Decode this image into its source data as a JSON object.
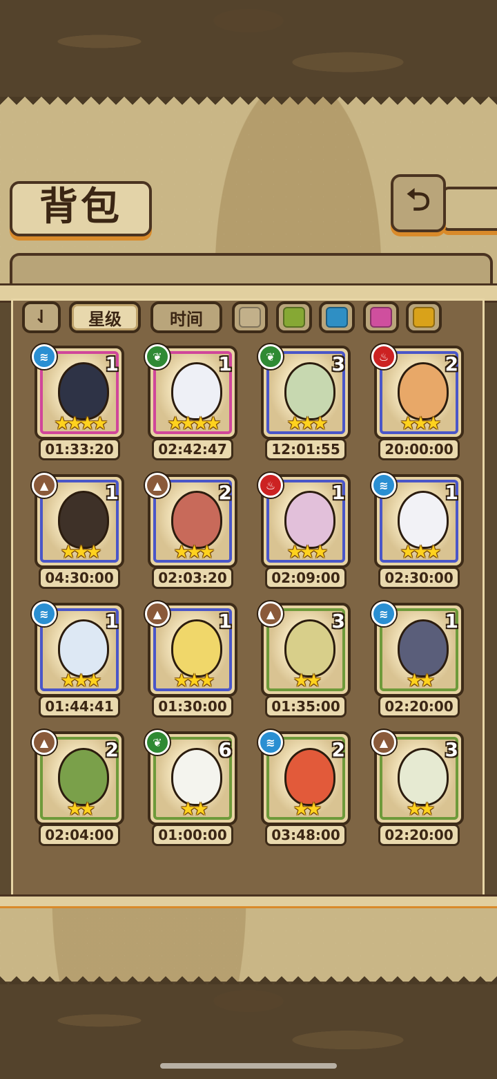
{
  "title": "背包",
  "back_icon": "⮌",
  "filters": {
    "sort_label": "⇃",
    "star_label": "星级",
    "time_label": "时间",
    "colors": [
      "#c2b08a",
      "#86a834",
      "#2f8fc4",
      "#cf4f9e",
      "#d9a21a"
    ]
  },
  "element_colors": {
    "water": "#2a8fd2",
    "leaf": "#2f8a34",
    "fire": "#cc2222",
    "earth": "#8a5a3a"
  },
  "rarity_colors": {
    "4": "#d0469a",
    "3": "#4a56c8",
    "2": "#6e9a3a"
  },
  "items": [
    {
      "count": "1",
      "stars": "★★★★",
      "timer": "01:33:20",
      "element": "water",
      "rarity": "4",
      "egg": "#2e3346"
    },
    {
      "count": "1",
      "stars": "★★★★",
      "timer": "02:42:47",
      "element": "leaf",
      "rarity": "4",
      "egg": "#eef0f6"
    },
    {
      "count": "3",
      "stars": "★★★",
      "timer": "12:01:55",
      "element": "leaf",
      "rarity": "3",
      "egg": "#c7d8b0"
    },
    {
      "count": "2",
      "stars": "★★★",
      "timer": "20:00:00",
      "element": "fire",
      "rarity": "3",
      "egg": "#e8a868"
    },
    {
      "count": "1",
      "stars": "★★★",
      "timer": "04:30:00",
      "element": "earth",
      "rarity": "3",
      "egg": "#3e3128"
    },
    {
      "count": "2",
      "stars": "★★★",
      "timer": "02:03:20",
      "element": "earth",
      "rarity": "3",
      "egg": "#c86a5a"
    },
    {
      "count": "1",
      "stars": "★★★",
      "timer": "02:09:00",
      "element": "fire",
      "rarity": "3",
      "egg": "#e2c0da"
    },
    {
      "count": "1",
      "stars": "★★★",
      "timer": "02:30:00",
      "element": "water",
      "rarity": "3",
      "egg": "#f2f2f6"
    },
    {
      "count": "1",
      "stars": "★★★",
      "timer": "01:44:41",
      "element": "water",
      "rarity": "3",
      "egg": "#dde8f4"
    },
    {
      "count": "1",
      "stars": "★★★",
      "timer": "01:30:00",
      "element": "earth",
      "rarity": "3",
      "egg": "#f0d76a"
    },
    {
      "count": "3",
      "stars": "★★",
      "timer": "01:35:00",
      "element": "earth",
      "rarity": "2",
      "egg": "#d8cf8a"
    },
    {
      "count": "1",
      "stars": "★★",
      "timer": "02:20:00",
      "element": "water",
      "rarity": "2",
      "egg": "#5a5e7a"
    },
    {
      "count": "2",
      "stars": "★★",
      "timer": "02:04:00",
      "element": "earth",
      "rarity": "2",
      "egg": "#7aa04a"
    },
    {
      "count": "6",
      "stars": "★★",
      "timer": "01:00:00",
      "element": "leaf",
      "rarity": "2",
      "egg": "#f4f4ee"
    },
    {
      "count": "2",
      "stars": "★★",
      "timer": "03:48:00",
      "element": "water",
      "rarity": "2",
      "egg": "#e25a3a"
    },
    {
      "count": "3",
      "stars": "★★",
      "timer": "02:20:00",
      "element": "earth",
      "rarity": "2",
      "egg": "#e6ead2"
    }
  ]
}
